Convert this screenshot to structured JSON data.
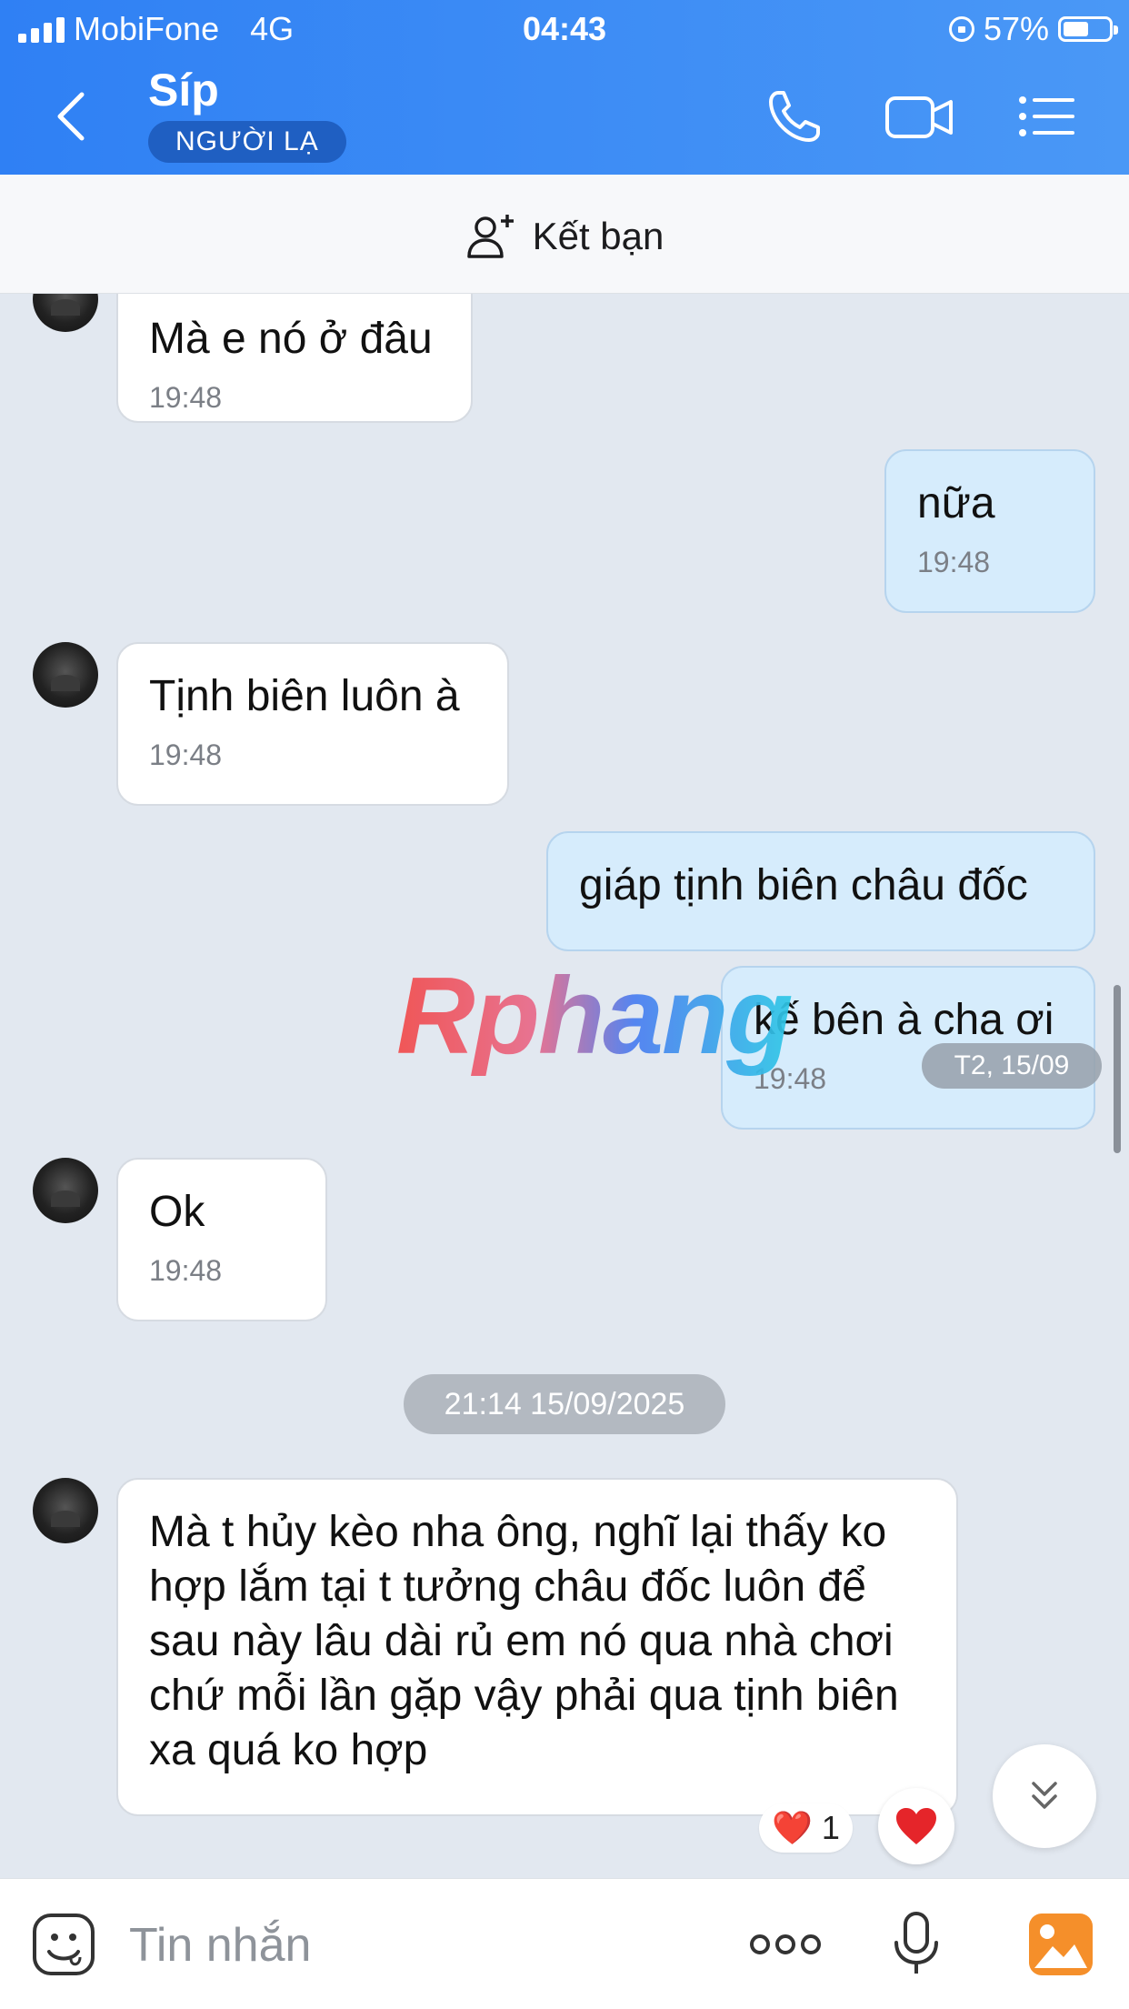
{
  "status_bar": {
    "carrier": "MobiFone",
    "network": "4G",
    "time": "04:43",
    "battery_percent": "57%",
    "battery_level": 0.57
  },
  "header": {
    "contact_name": "Síp",
    "badge": "NGƯỜI LẠ",
    "icons": [
      "back-icon",
      "phone-icon",
      "video-call-icon",
      "menu-icon"
    ],
    "accent": "#2f80f4"
  },
  "friend_bar": {
    "label": "Kết bạn",
    "icon": "add-friend-icon"
  },
  "messages": [
    {
      "side": "in",
      "text": "Mà e nó ở đâu",
      "time": "19:48"
    },
    {
      "side": "out",
      "text": "nữa",
      "time": "19:48"
    },
    {
      "side": "in",
      "text": "Tịnh biên luôn à",
      "time": "19:48"
    },
    {
      "side": "out",
      "text": "giáp tịnh biên châu đốc"
    },
    {
      "side": "out",
      "text": "kế bên à cha ơi",
      "time": "19:48"
    },
    {
      "side": "in",
      "text": "Ok",
      "time": "19:48"
    },
    {
      "side": "in",
      "text": "Mà t hủy kèo nha ông, nghĩ lại thấy ko hợp lắm tại t tưởng châu đốc luôn để sau này lâu dài rủ em nó qua nhà chơi chứ mỗi lần gặp vậy phải qua tịnh biên xa quá ko hợp"
    }
  ],
  "date_chips": {
    "scroll_date": "T2, 15/09",
    "separator": "21:14 15/09/2025"
  },
  "watermark": "Rphang",
  "reaction": {
    "emoji": "❤️",
    "count": "1"
  },
  "composer": {
    "placeholder": "Tin nhắn",
    "icons": [
      "sticker-icon",
      "more-icon",
      "microphone-icon",
      "image-icon"
    ]
  }
}
